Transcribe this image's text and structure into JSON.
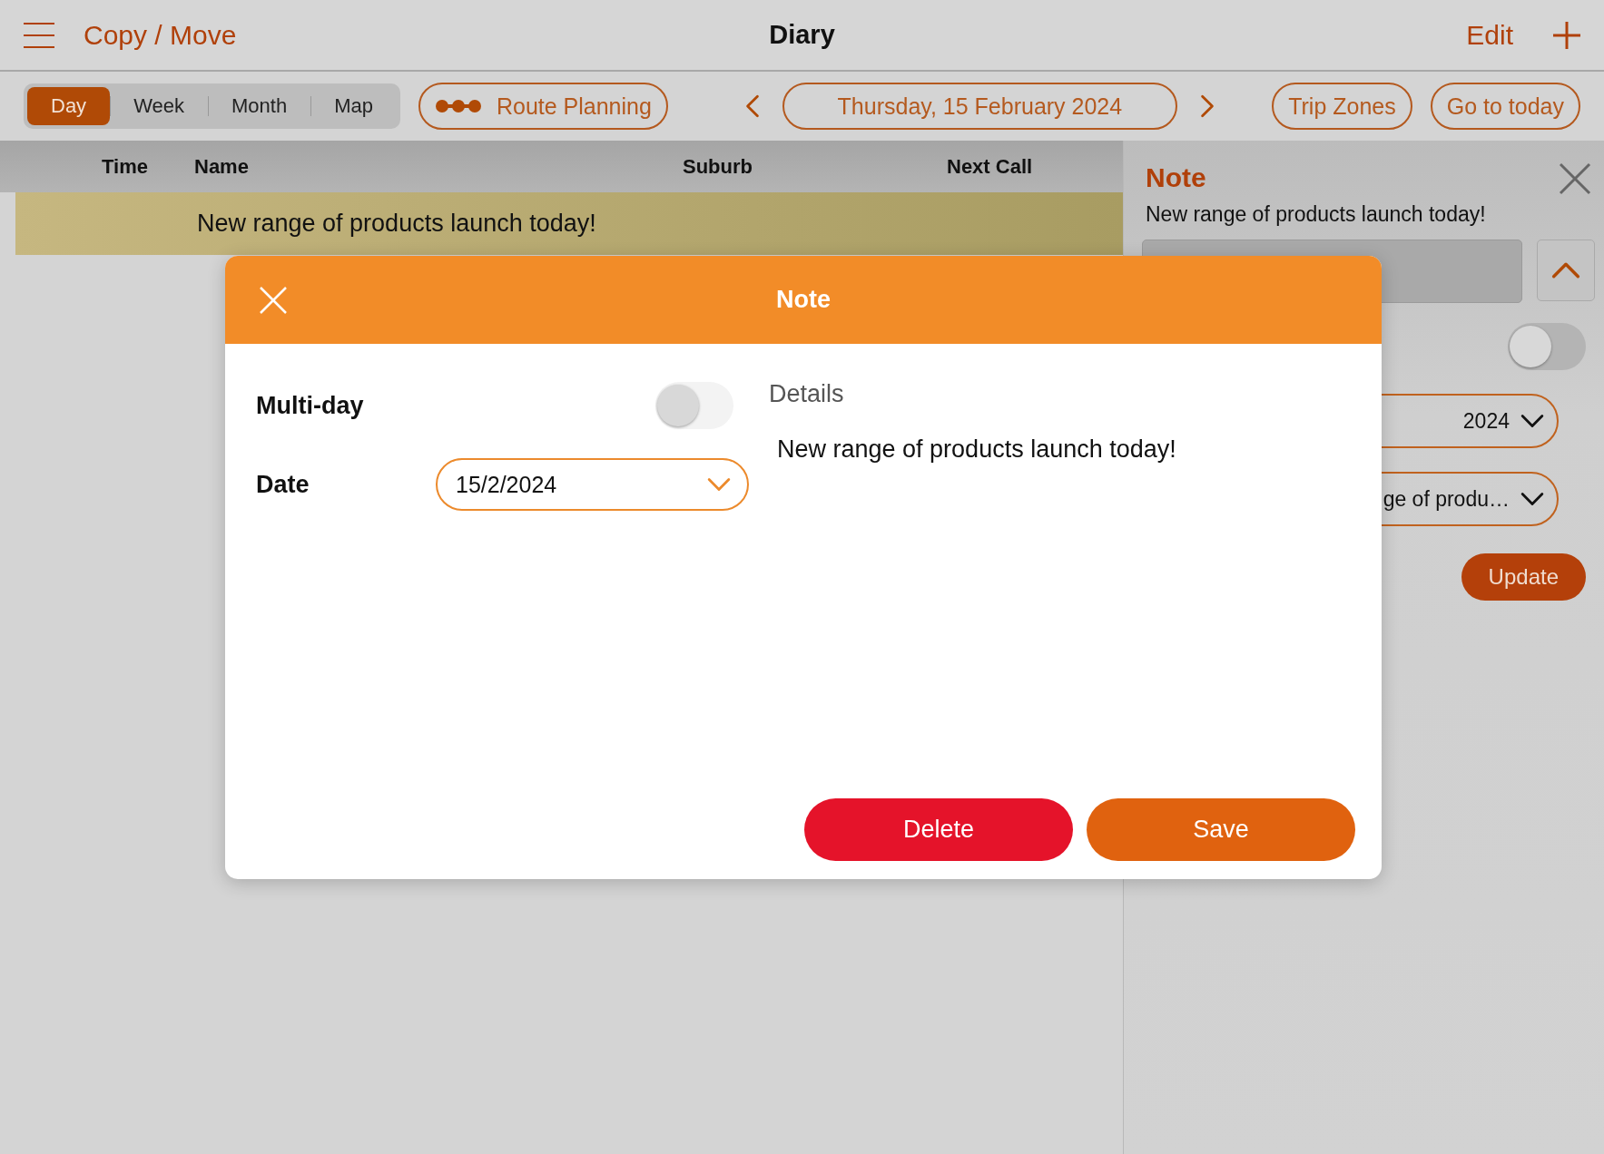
{
  "top_bar": {
    "menu_link": "Copy / Move",
    "title": "Diary",
    "edit": "Edit"
  },
  "view_tabs": [
    {
      "label": "Day",
      "selected": true
    },
    {
      "label": "Week",
      "selected": false
    },
    {
      "label": "Month",
      "selected": false
    },
    {
      "label": "Map",
      "selected": false
    }
  ],
  "route_planning": "Route Planning",
  "date_nav": {
    "date": "Thursday, 15 February 2024"
  },
  "actions": [
    "Trip Zones",
    "Go to today"
  ],
  "table": {
    "columns": [
      "Time",
      "Name",
      "Suburb",
      "Next Call"
    ],
    "rows": [
      {
        "kind": "note",
        "text": "New range of products launch today!"
      }
    ]
  },
  "side_panel": {
    "title": "Note",
    "subtitle": "New range of products launch today!",
    "toggle_on": false,
    "date_select": "2024",
    "note_select": "ge of produ…",
    "update": "Update"
  },
  "dialog": {
    "title": "Note",
    "multi_day": {
      "label": "Multi-day",
      "on": false
    },
    "date": {
      "label": "Date",
      "value": "15/2/2024"
    },
    "details": {
      "label": "Details",
      "text": "New range of products launch today!"
    },
    "buttons": [
      {
        "kind": "delete",
        "label": "Delete"
      },
      {
        "kind": "save",
        "label": "Save"
      }
    ]
  }
}
